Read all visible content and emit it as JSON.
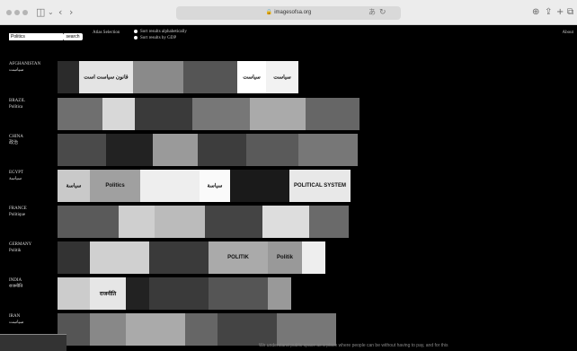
{
  "browser": {
    "url": "imagesofsa.org"
  },
  "toolbar": {
    "search_value": "Politics",
    "search_button": "search",
    "atlas_link": "Atlas Selection",
    "sort_options": [
      "Sort results alphabetically",
      "Sort results by GDP"
    ],
    "about_link": "About"
  },
  "countries": [
    {
      "name": "AFGHANISTAN",
      "native": "سیاست",
      "thumbs": [
        {
          "w": 24,
          "c": "#2b2b2b",
          "t": ""
        },
        {
          "w": 60,
          "c": "#e4e4e4",
          "t": "قانون سیاست است"
        },
        {
          "w": 56,
          "c": "#8a8a8a",
          "t": ""
        },
        {
          "w": 60,
          "c": "#555",
          "t": ""
        },
        {
          "w": 32,
          "c": "#fff",
          "t": "سیاست"
        },
        {
          "w": 36,
          "c": "#f2f2f2",
          "t": "سیاست"
        }
      ]
    },
    {
      "name": "BRAZIL",
      "native": "Política",
      "thumbs": [
        {
          "w": 50,
          "c": "#6f6f6f",
          "t": ""
        },
        {
          "w": 36,
          "c": "#d8d8d8",
          "t": ""
        },
        {
          "w": 64,
          "c": "#3a3a3a",
          "t": ""
        },
        {
          "w": 64,
          "c": "#777",
          "t": ""
        },
        {
          "w": 62,
          "c": "#aaa",
          "t": ""
        },
        {
          "w": 60,
          "c": "#666",
          "t": ""
        }
      ]
    },
    {
      "name": "CHINA",
      "native": "政治",
      "thumbs": [
        {
          "w": 54,
          "c": "#4a4a4a",
          "t": ""
        },
        {
          "w": 52,
          "c": "#222",
          "t": ""
        },
        {
          "w": 50,
          "c": "#9a9a9a",
          "t": ""
        },
        {
          "w": 54,
          "c": "#3d3d3d",
          "t": ""
        },
        {
          "w": 58,
          "c": "#5a5a5a",
          "t": ""
        },
        {
          "w": 66,
          "c": "#777",
          "t": ""
        }
      ]
    },
    {
      "name": "EGYPT",
      "native": "سياسة",
      "thumbs": [
        {
          "w": 36,
          "c": "#c9c9c9",
          "t": "سياسة"
        },
        {
          "w": 56,
          "c": "#a0a0a0",
          "t": "Politics"
        },
        {
          "w": 66,
          "c": "#eee",
          "t": ""
        },
        {
          "w": 34,
          "c": "#fafafa",
          "t": "سياسة"
        },
        {
          "w": 66,
          "c": "#1a1a1a",
          "t": ""
        },
        {
          "w": 68,
          "c": "#e8e8e8",
          "t": "POLITICAL SYSTEM"
        }
      ]
    },
    {
      "name": "FRANCE",
      "native": "Politique",
      "thumbs": [
        {
          "w": 68,
          "c": "#5a5a5a",
          "t": ""
        },
        {
          "w": 40,
          "c": "#cfcfcf",
          "t": ""
        },
        {
          "w": 56,
          "c": "#bbb",
          "t": ""
        },
        {
          "w": 64,
          "c": "#444",
          "t": ""
        },
        {
          "w": 52,
          "c": "#ddd",
          "t": ""
        },
        {
          "w": 44,
          "c": "#6a6a6a",
          "t": ""
        }
      ]
    },
    {
      "name": "GERMANY",
      "native": "Politik",
      "thumbs": [
        {
          "w": 36,
          "c": "#333",
          "t": ""
        },
        {
          "w": 66,
          "c": "#d0d0d0",
          "t": ""
        },
        {
          "w": 66,
          "c": "#3a3a3a",
          "t": ""
        },
        {
          "w": 66,
          "c": "#aaa",
          "t": "POLITIK"
        },
        {
          "w": 38,
          "c": "#999",
          "t": "Politik"
        },
        {
          "w": 26,
          "c": "#eee",
          "t": ""
        }
      ]
    },
    {
      "name": "INDIA",
      "native": "राजनीति",
      "thumbs": [
        {
          "w": 36,
          "c": "#ccc",
          "t": ""
        },
        {
          "w": 40,
          "c": "#e6e6e6",
          "t": "राजनीति"
        },
        {
          "w": 26,
          "c": "#222",
          "t": ""
        },
        {
          "w": 66,
          "c": "#3a3a3a",
          "t": ""
        },
        {
          "w": 66,
          "c": "#555",
          "t": ""
        },
        {
          "w": 26,
          "c": "#999",
          "t": ""
        }
      ]
    },
    {
      "name": "IRAN",
      "native": "سیاست",
      "thumbs": [
        {
          "w": 36,
          "c": "#555",
          "t": ""
        },
        {
          "w": 40,
          "c": "#888",
          "t": ""
        },
        {
          "w": 66,
          "c": "#aaa",
          "t": ""
        },
        {
          "w": 36,
          "c": "#666",
          "t": ""
        },
        {
          "w": 66,
          "c": "#444",
          "t": ""
        },
        {
          "w": 66,
          "c": "#777",
          "t": ""
        }
      ]
    }
  ],
  "footer": {
    "text": "We understand public space as a place where people can be without having to pay, and for this"
  }
}
